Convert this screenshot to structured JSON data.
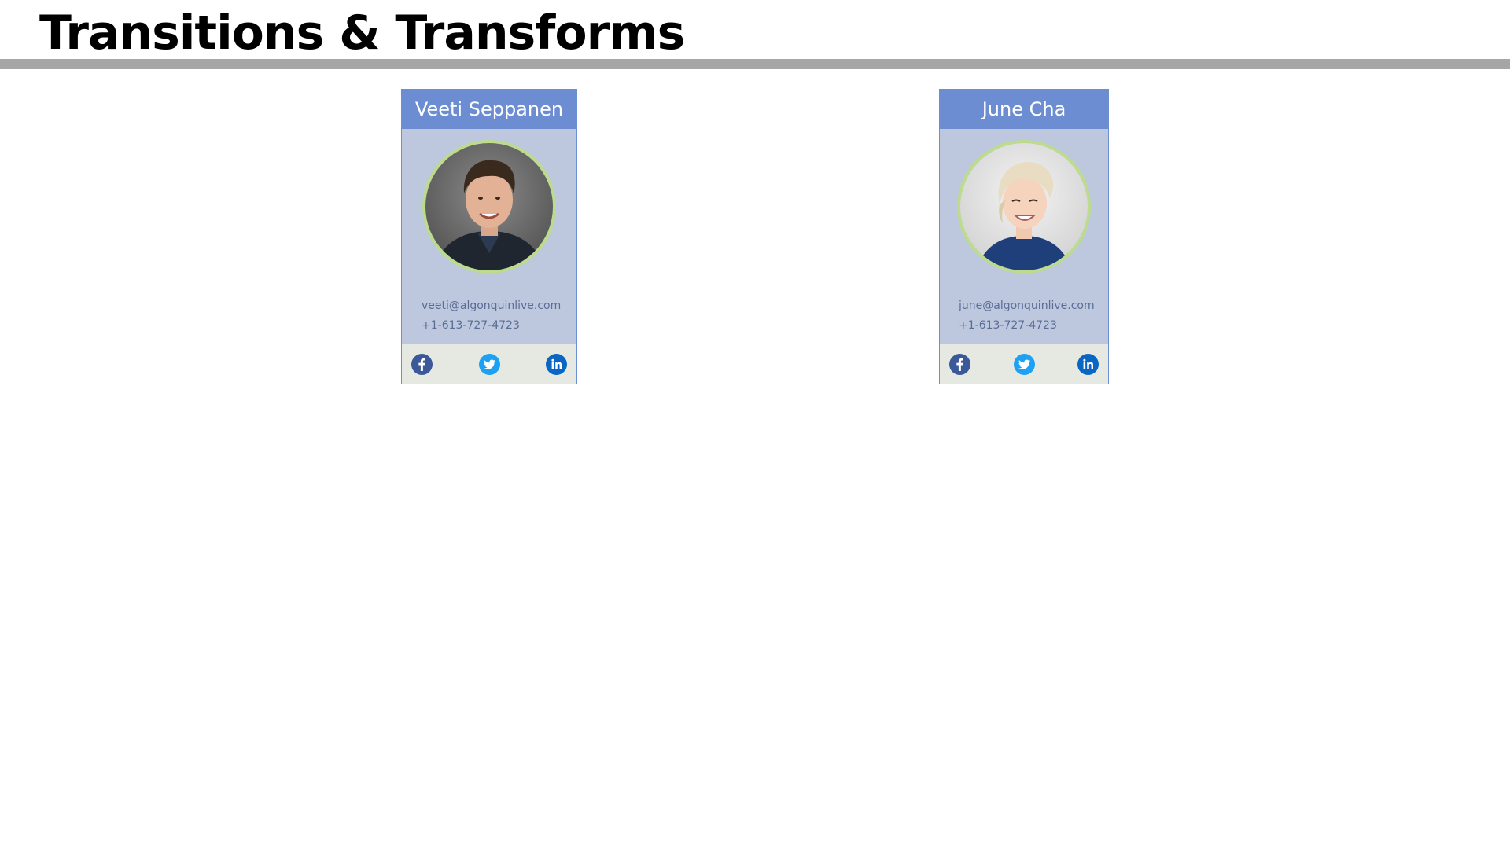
{
  "page": {
    "title": "Transitions & Transforms"
  },
  "cards": [
    {
      "name": "Veeti Seppanen",
      "email": "veeti@algonquinlive.com",
      "phone": "+1-613-727-4723",
      "social": [
        "facebook-icon",
        "twitter-icon",
        "linkedin-icon"
      ]
    },
    {
      "name": "June Cha",
      "email": "june@algonquinlive.com",
      "phone": "+1-613-727-4723",
      "social": [
        "facebook-icon",
        "twitter-icon",
        "linkedin-icon"
      ]
    }
  ],
  "colors": {
    "card_header": "#6d8dd3",
    "card_body": "#bdc8df",
    "card_border": "#6c8fd2",
    "avatar_ring": "#bcdb8c",
    "social_bar": "#e5e9e1",
    "facebook": "#3b5998",
    "twitter": "#1da1f2",
    "linkedin": "#0a66c2",
    "header_rule": "#a6a6a6"
  }
}
